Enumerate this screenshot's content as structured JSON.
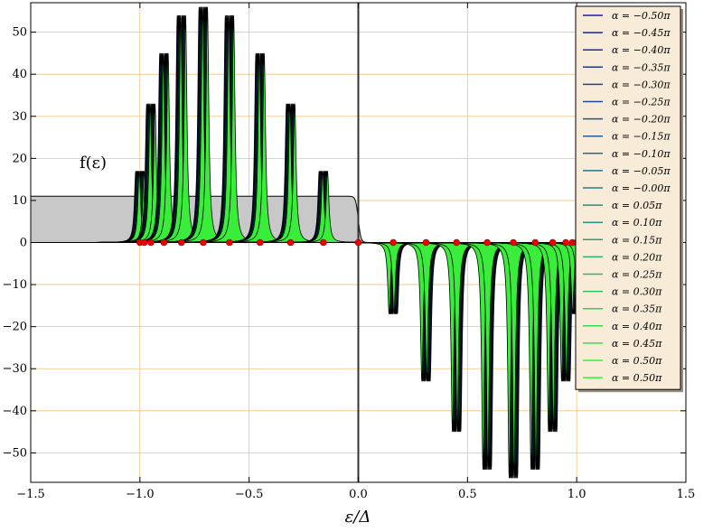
{
  "chart_data": {
    "type": "line",
    "xlabel": "ε/Δ",
    "ylabel": "",
    "annotation": "f(ε)",
    "xlim": [
      -1.5,
      1.5
    ],
    "ylim": [
      -57,
      57
    ],
    "grid": true,
    "legend_position": "top-right",
    "x_ticks": [
      -1.5,
      -1.0,
      -0.5,
      0.0,
      0.5,
      1.0,
      1.5
    ],
    "x_tick_labels": [
      "−1.5",
      "−1.0",
      "−0.5",
      "0.0",
      "0.5",
      "1.0",
      "1.5"
    ],
    "y_ticks": [
      -50,
      -40,
      -30,
      -20,
      -10,
      0,
      10,
      20,
      30,
      40,
      50
    ],
    "y_tick_labels": [
      "−50",
      "−40",
      "−30",
      "−20",
      "−10",
      "0",
      "10",
      "20",
      "30",
      "40",
      "50"
    ],
    "background_curve": {
      "description_value_plateau": 11,
      "x_start": -1.5,
      "x_end": 0.0,
      "color": "#c8c8c8"
    },
    "peaks_positive": [
      {
        "x": -1.0,
        "height": 17
      },
      {
        "x": -0.95,
        "height": 33
      },
      {
        "x": -0.89,
        "height": 45
      },
      {
        "x": -0.81,
        "height": 54
      },
      {
        "x": -0.71,
        "height": 56
      },
      {
        "x": -0.59,
        "height": 54
      },
      {
        "x": -0.45,
        "height": 45
      },
      {
        "x": -0.31,
        "height": 33
      },
      {
        "x": -0.16,
        "height": 17
      }
    ],
    "peaks_negative": [
      {
        "x": 0.16,
        "height": -17
      },
      {
        "x": 0.31,
        "height": -33
      },
      {
        "x": 0.45,
        "height": -45
      },
      {
        "x": 0.59,
        "height": -54
      },
      {
        "x": 0.71,
        "height": -56
      },
      {
        "x": 0.81,
        "height": -54
      },
      {
        "x": 0.89,
        "height": -45
      },
      {
        "x": 0.95,
        "height": -33
      },
      {
        "x": 1.0,
        "height": -17
      }
    ],
    "red_markers_x": [
      -1.0,
      -0.98,
      -0.95,
      -0.89,
      -0.81,
      -0.71,
      -0.59,
      -0.45,
      -0.31,
      -0.16,
      0.0,
      0.16,
      0.31,
      0.45,
      0.59,
      0.71,
      0.81,
      0.89,
      0.95,
      0.98,
      1.0
    ],
    "series": [
      {
        "name": "α = −0.50π",
        "color": "#1a1aa8"
      },
      {
        "name": "α = −0.45π",
        "color": "#1b22a6"
      },
      {
        "name": "α = −0.40π",
        "color": "#1c2ba4"
      },
      {
        "name": "α = −0.35π",
        "color": "#1d35a2"
      },
      {
        "name": "α = −0.30π",
        "color": "#1e40a0"
      },
      {
        "name": "α = −0.25π",
        "color": "#1f4b9d"
      },
      {
        "name": "α = −0.20π",
        "color": "#20569a"
      },
      {
        "name": "α = −0.15π",
        "color": "#216197"
      },
      {
        "name": "α = −0.10π",
        "color": "#226b93"
      },
      {
        "name": "α = −0.05π",
        "color": "#237590"
      },
      {
        "name": "α = −0.00π",
        "color": "#24808b"
      },
      {
        "name": "α = 0.05π",
        "color": "#268b86"
      },
      {
        "name": "α = 0.10π",
        "color": "#289680"
      },
      {
        "name": "α = 0.15π",
        "color": "#2aa079"
      },
      {
        "name": "α = 0.20π",
        "color": "#2cab72"
      },
      {
        "name": "α = 0.25π",
        "color": "#2eb66a"
      },
      {
        "name": "α = 0.30π",
        "color": "#30c161"
      },
      {
        "name": "α = 0.35π",
        "color": "#32cc57"
      },
      {
        "name": "α = 0.40π",
        "color": "#34d74d"
      },
      {
        "name": "α = 0.45π",
        "color": "#37e243"
      },
      {
        "name": "α = 0.50π",
        "color": "#3aed3a"
      },
      {
        "name": "α = 0.50π",
        "color": "#3aed3a"
      }
    ],
    "colors": {
      "grid": "#f0c27a",
      "marker": "#ee0000",
      "legend_bg": "#f8ecd8",
      "axis": "#000000",
      "vline": "#333333"
    }
  }
}
